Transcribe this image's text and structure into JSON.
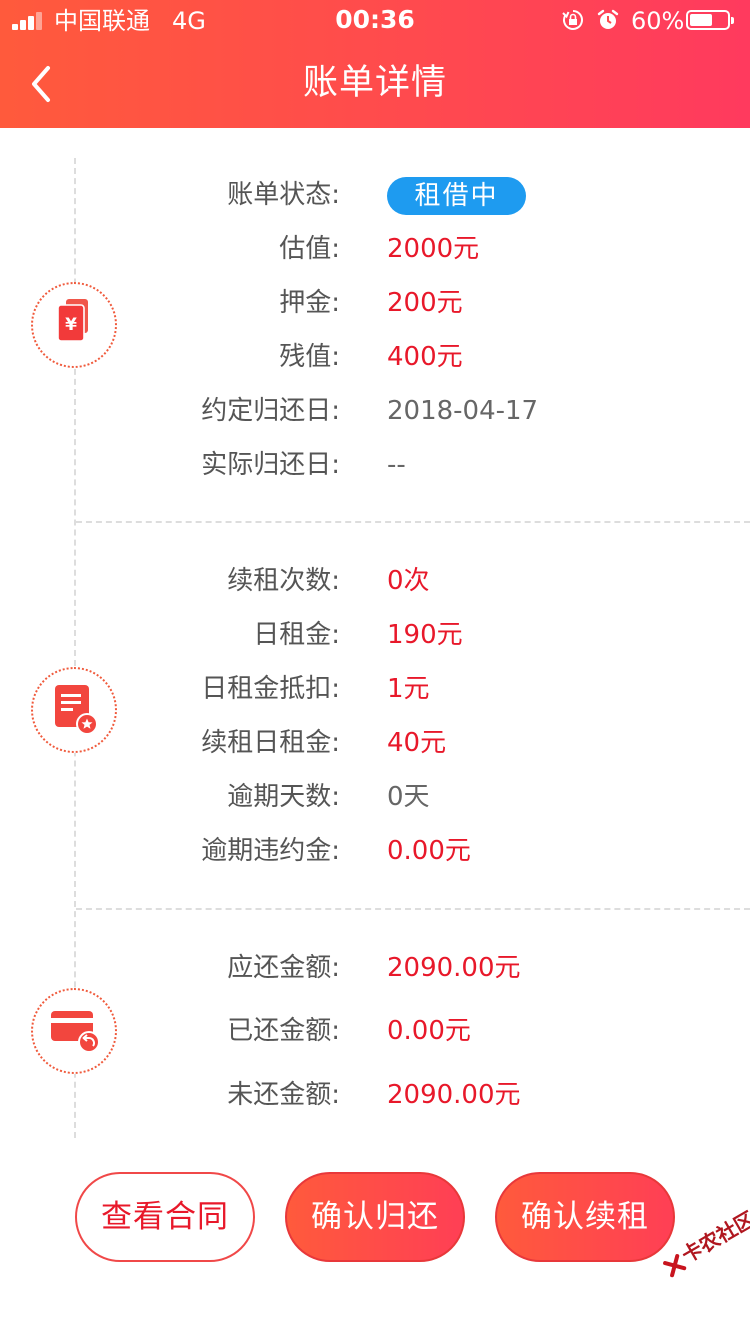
{
  "status_bar": {
    "carrier": "中国联通",
    "network": "4G",
    "time": "00:36",
    "battery_percent": "60%",
    "battery_level": 0.6,
    "icons": [
      "signal-icon",
      "orientation-lock-icon",
      "alarm-icon",
      "battery-icon"
    ]
  },
  "nav": {
    "title": "账单详情",
    "back_icon": "chevron-left-icon"
  },
  "bill_info": {
    "icon": "bill-yuan-icon",
    "status_label": "账单状态:",
    "status_value": "租借中",
    "rows": [
      {
        "label": "估值:",
        "value": "2000元"
      },
      {
        "label": "押金:",
        "value": "200元"
      },
      {
        "label": "残值:",
        "value": "400元"
      },
      {
        "label": "约定归还日:",
        "value": "2018-04-17"
      },
      {
        "label": "实际归还日:",
        "value": "--"
      }
    ]
  },
  "rent_info": {
    "icon": "document-badge-icon",
    "rows": [
      {
        "label": "续租次数:",
        "value": "0次"
      },
      {
        "label": "日租金:",
        "value": "190元"
      },
      {
        "label": "日租金抵扣:",
        "value": "1元"
      },
      {
        "label": "续租日租金:",
        "value": "40元"
      },
      {
        "label": "逾期天数:",
        "value": "0天"
      },
      {
        "label": "逾期违约金:",
        "value": "0.00元"
      }
    ]
  },
  "repayment_info": {
    "icon": "card-return-icon",
    "rows": [
      {
        "label": "应还金额:",
        "value": "2090.00元"
      },
      {
        "label": "已还金额:",
        "value": "0.00元"
      },
      {
        "label": "未还金额:",
        "value": "2090.00元"
      }
    ]
  },
  "actions": {
    "view_contract": "查看合同",
    "confirm_return": "确认归还",
    "confirm_renew": "确认续租"
  },
  "watermark": {
    "text": "卡农社区",
    "icon": "kanong-logo-icon"
  },
  "colors": {
    "header_start": "#ff5a3c",
    "header_end": "#ff3a5e",
    "accent_red": "#e8182a",
    "status_blue": "#1e9bf0",
    "label_grey": "#555555"
  }
}
